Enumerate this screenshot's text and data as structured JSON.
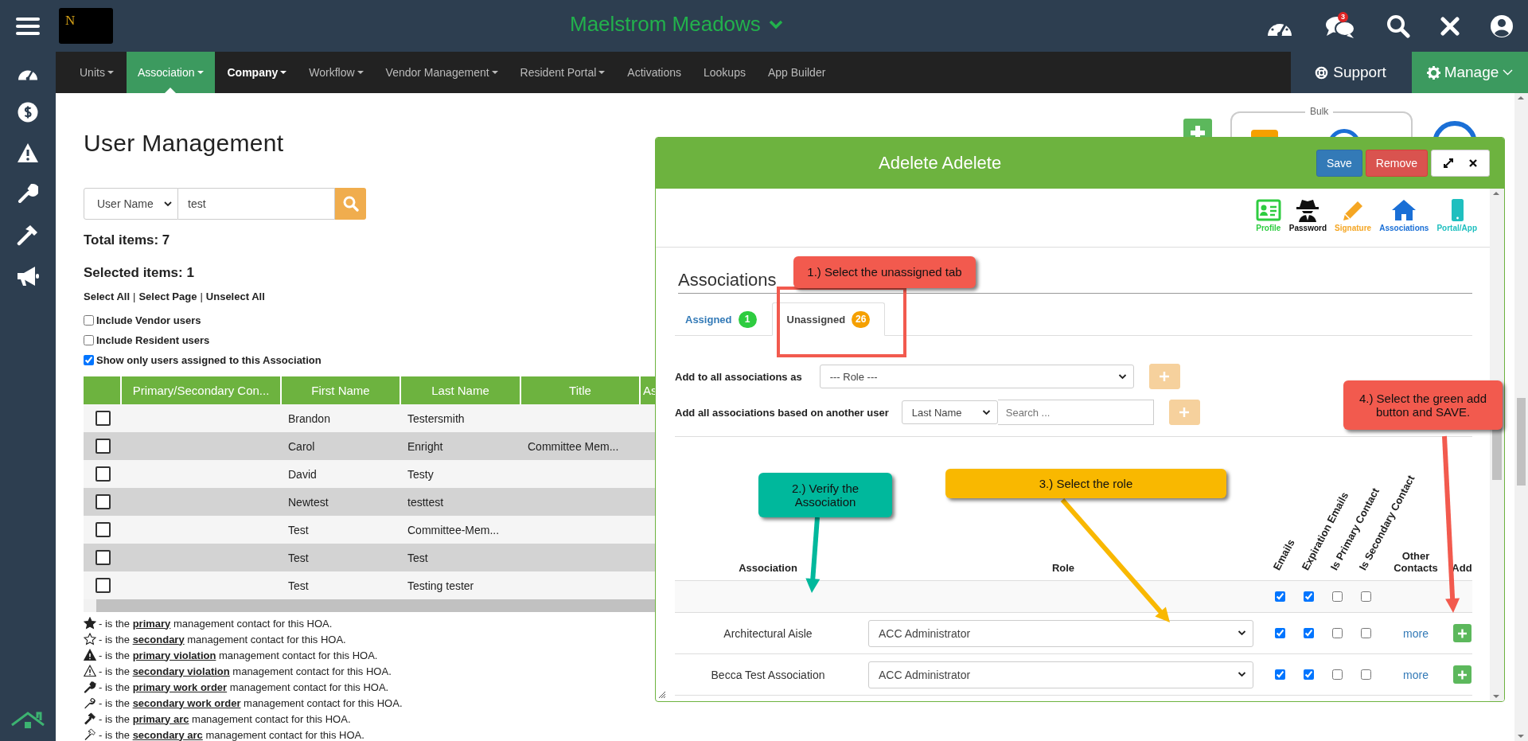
{
  "app": {
    "logo": "N",
    "title": "Maelstrom Meadows",
    "notifications": "3"
  },
  "nav": {
    "items": [
      {
        "label": "Units",
        "dropdown": true,
        "selected": false
      },
      {
        "label": "Association",
        "dropdown": true,
        "selected": true
      },
      {
        "label": "Company",
        "dropdown": true,
        "selected": false
      },
      {
        "label": "Workflow",
        "dropdown": true,
        "selected": false
      },
      {
        "label": "Vendor Management",
        "dropdown": true,
        "selected": false
      },
      {
        "label": "Resident Portal",
        "dropdown": true,
        "selected": false
      },
      {
        "label": "Activations",
        "dropdown": false,
        "selected": false
      },
      {
        "label": "Lookups",
        "dropdown": false,
        "selected": false
      },
      {
        "label": "App Builder",
        "dropdown": false,
        "selected": false
      }
    ],
    "support": "Support",
    "manage": "Manage"
  },
  "page": {
    "title": "User Management",
    "search_by": "User Name",
    "search_value": "test",
    "total": "Total items: 7",
    "selected_count": "Selected items: 1",
    "select_links": [
      "Select All",
      "Select Page",
      "Unselect All"
    ],
    "link_separator": "|",
    "filters": [
      {
        "label": "Include Vendor users",
        "checked": false
      },
      {
        "label": "Include Resident users",
        "checked": false
      },
      {
        "label": "Show only users assigned to this Association",
        "checked": true
      }
    ],
    "bulk_label": "Bulk",
    "table": {
      "columns": [
        "Primary/Secondary Con...",
        "First Name",
        "Last Name",
        "Title",
        "As"
      ],
      "rows": [
        {
          "checked": false,
          "first": "Brandon",
          "last": "Testersmith"
        },
        {
          "checked": false,
          "first": "Carol",
          "last": "Enright",
          "title": "Committee Mem..."
        },
        {
          "checked": false,
          "first": "David",
          "last": "Testy"
        },
        {
          "checked": false,
          "first": "Newtest",
          "last": "testtest"
        },
        {
          "checked": false,
          "first": "Test",
          "last": "Committee-Mem..."
        },
        {
          "checked": false,
          "first": "Test",
          "last": "Test"
        },
        {
          "checked": false,
          "first": "Test",
          "last": "Testing tester"
        }
      ]
    },
    "legend": [
      "- is the **primary** management contact for this HOA.",
      "- is the **secondary** management contact for this HOA.",
      "- is the **primary violation** management contact for this HOA.",
      "- is the **secondary violation** management contact for this HOA.",
      "- is the **primary work order** management contact for this HOA.",
      "- is the **secondary work order** management contact for this HOA.",
      "- is the **primary arc** management contact for this HOA.",
      "- is the **secondary arc** management contact for this HOA."
    ]
  },
  "modal": {
    "title": "Adelete Adelete",
    "save": "Save",
    "remove": "Remove",
    "sections": [
      {
        "kind": "profile",
        "label": "Profile",
        "color": "#2ecc40"
      },
      {
        "kind": "password",
        "label": "Password",
        "color": "#111111"
      },
      {
        "kind": "signature",
        "label": "Signature",
        "color": "#f5a623"
      },
      {
        "kind": "associations",
        "label": "Associations",
        "color": "#1a6fd6"
      },
      {
        "kind": "portal",
        "label": "Portal/App",
        "color": "#1fbfbf"
      }
    ],
    "heading": "Associations",
    "tabs": [
      {
        "label": "Assigned",
        "count": "1",
        "color": "#2ecc40",
        "selected": false
      },
      {
        "label": "Unassigned",
        "count": "26",
        "color": "#f5a000",
        "selected": true
      }
    ],
    "add_all": {
      "label": "Add to all associations as",
      "value": "--- Role ---",
      "disabled": true
    },
    "add_from_user": {
      "label": "Add all associations based on another user",
      "search_by": "Last Name",
      "placeholder": "Search ...",
      "disabled": true
    },
    "columns": [
      {
        "label": "Association",
        "rotated": false
      },
      {
        "label": "Role",
        "rotated": false
      },
      {
        "label": "Emails",
        "rotated": true
      },
      {
        "label": "Expiration Emails",
        "rotated": true
      },
      {
        "label": "Is Primary Contact",
        "rotated": true
      },
      {
        "label": "Is Secondary Contact",
        "rotated": true
      },
      {
        "label": "Other Contacts",
        "rotated": false
      },
      {
        "label": "Add",
        "rotated": false
      }
    ],
    "defaults": {
      "emails": true,
      "expiration_emails": true,
      "primary": false,
      "secondary": false
    },
    "rows": [
      {
        "association": "Architectural Aisle",
        "role": "ACC Administrator",
        "emails": true,
        "expiration_emails": true,
        "primary": false,
        "secondary": false,
        "other": "more"
      },
      {
        "association": "Becca Test Association",
        "role": "ACC Administrator",
        "emails": true,
        "expiration_emails": true,
        "primary": false,
        "secondary": false,
        "other": "more"
      }
    ]
  },
  "callouts": [
    {
      "text": "1.) Select the unassigned tab",
      "color": "#f25a4e"
    },
    {
      "text": "2.) Verify the Association",
      "color": "#00b89c"
    },
    {
      "text": "3.) Select the role",
      "color": "#f9b800"
    },
    {
      "text": "4.) Select the green add button and SAVE.",
      "color": "#f25a4e"
    }
  ]
}
